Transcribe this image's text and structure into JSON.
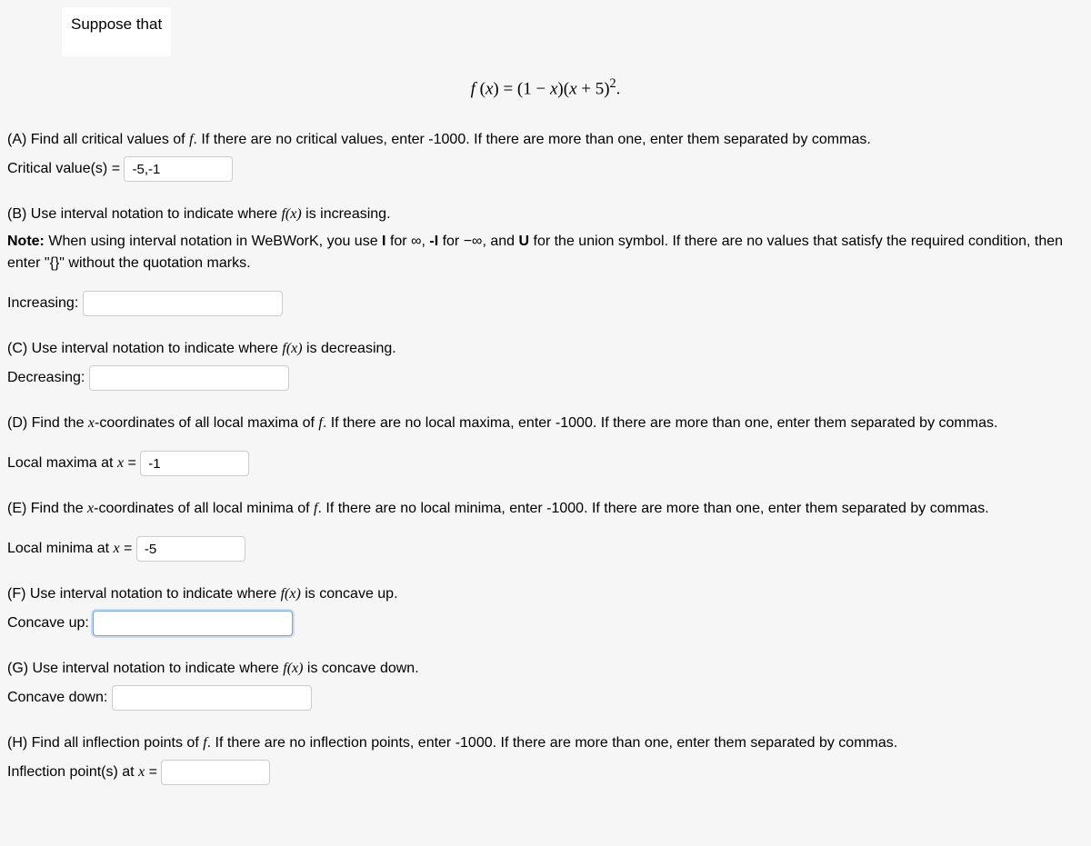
{
  "intro": "Suppose that",
  "formula_html": "<span class='fx'>f</span> (<span class='fx'>x</span>) = (1 − <span class='fx'>x</span>)(<span class='fx'>x</span> + 5)<span class='sup'>2</span>.",
  "partA": {
    "text_before": "(A) Find all critical values of ",
    "text_after": ". If there are no critical values, enter -1000. If there are more than one, enter them separated by commas.",
    "label": "Critical value(s) = ",
    "value": "-5,-1"
  },
  "partB": {
    "text_before": "(B) Use interval notation to indicate where ",
    "text_after": " is increasing.",
    "note_prefix": "Note:",
    "note_body": " When using interval notation in WeBWorK, you use ",
    "note_i": "I",
    "note_for_inf": " for ∞, ",
    "note_neg_i": "-I",
    "note_for_neginf": " for −∞, and ",
    "note_u": "U",
    "note_rest": " for the union symbol. If there are no values that satisfy the required condition, then enter \"{}\" without the quotation marks.",
    "label": "Increasing:",
    "value": ""
  },
  "partC": {
    "text_before": "(C) Use interval notation to indicate where ",
    "text_after": " is decreasing.",
    "label": "Decreasing:",
    "value": ""
  },
  "partD": {
    "text_before": "(D) Find the ",
    "text_mid": "-coordinates of all local maxima of ",
    "text_after": ". If there are no local maxima, enter -1000. If there are more than one, enter them separated by commas.",
    "label_before": "Local maxima at ",
    "label_after": " = ",
    "value": "-1"
  },
  "partE": {
    "text_before": "(E) Find the ",
    "text_mid": "-coordinates of all local minima of ",
    "text_after": ". If there are no local minima, enter -1000. If there are more than one, enter them separated by commas.",
    "label_before": "Local minima at ",
    "label_after": " = ",
    "value": "-5"
  },
  "partF": {
    "text_before": "(F) Use interval notation to indicate where ",
    "text_after": " is concave up.",
    "label": "Concave up:",
    "value": ""
  },
  "partG": {
    "text_before": "(G) Use interval notation to indicate where ",
    "text_after": " is concave down.",
    "label": "Concave down:",
    "value": ""
  },
  "partH": {
    "text_before": "(H) Find all inflection points of ",
    "text_after": ". If there are no inflection points, enter -1000. If there are more than one, enter them separated by commas.",
    "label_before": "Inflection point(s) at ",
    "label_after": " = ",
    "value": ""
  }
}
